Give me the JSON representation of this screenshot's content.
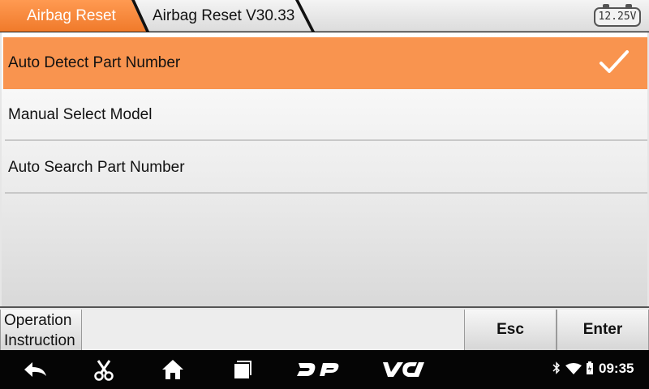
{
  "breadcrumb": {
    "items": [
      "Airbag Reset",
      "Airbag Reset V30.33"
    ]
  },
  "battery": {
    "voltage": "12.25V"
  },
  "menu": {
    "items": [
      {
        "label": "Auto Detect Part Number",
        "selected": true
      },
      {
        "label": "Manual Select Model",
        "selected": false
      },
      {
        "label": "Auto Search Part Number",
        "selected": false
      }
    ]
  },
  "buttons": {
    "operation_instruction": [
      "Operation",
      "Instruction"
    ],
    "esc": "Esc",
    "enter": "Enter"
  },
  "navbar": {
    "icons": [
      "back-icon",
      "scissors-icon",
      "home-icon",
      "recents-icon",
      "dp-icon",
      "vci-icon"
    ],
    "status_icons": [
      "bluetooth-icon",
      "wifi-icon",
      "battery-icon"
    ],
    "time": "09:35"
  },
  "colors": {
    "accent": "#f9944f",
    "breadcrumb_active": "#f07a2a"
  }
}
